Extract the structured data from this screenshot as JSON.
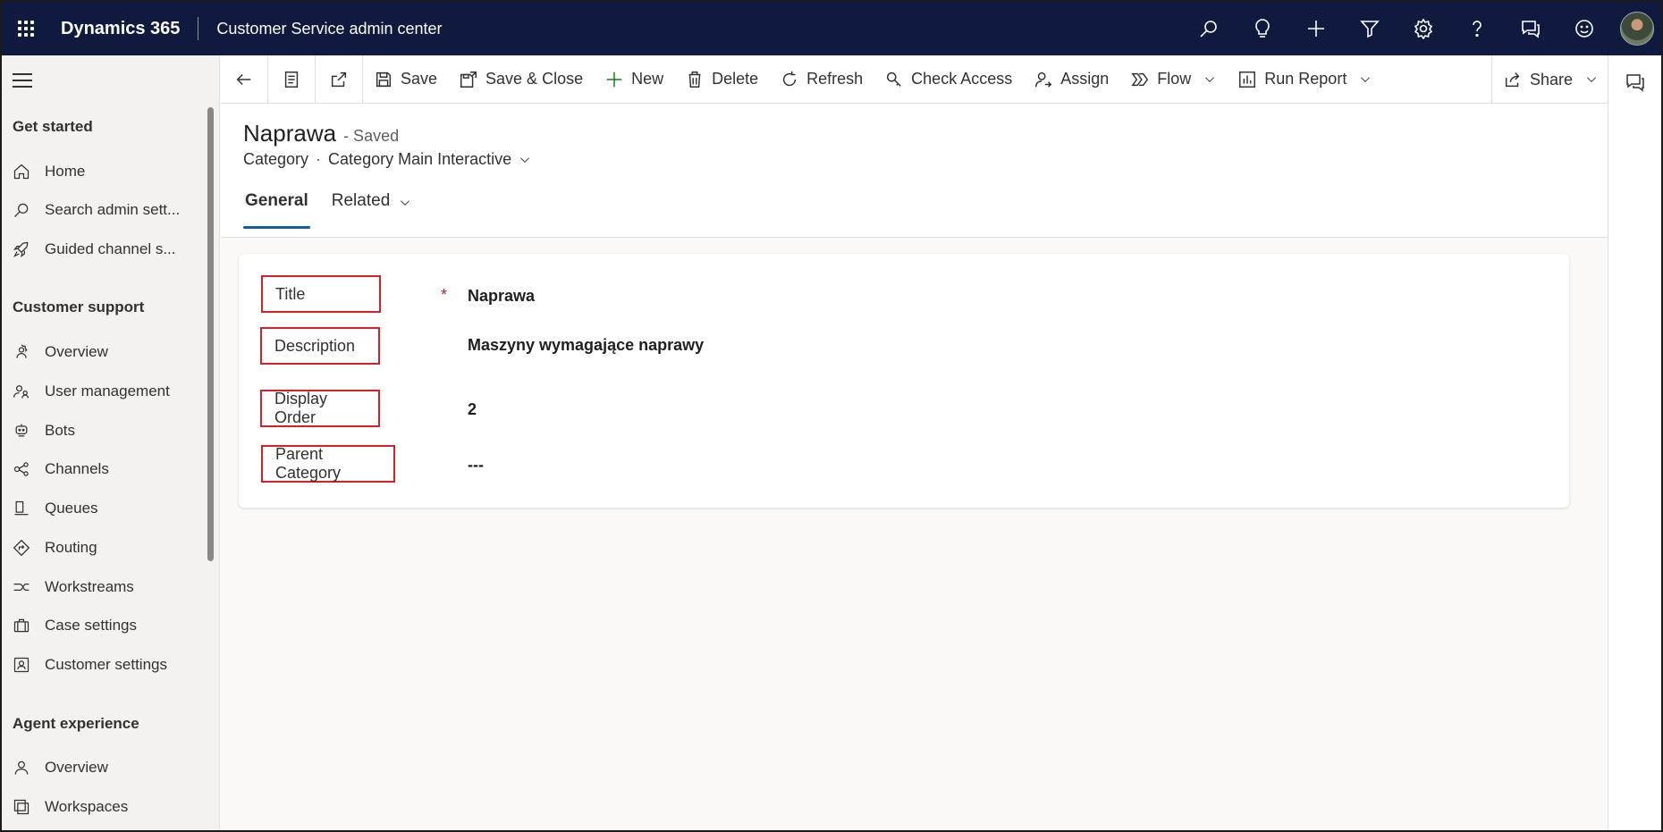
{
  "topbar": {
    "brand": "Dynamics 365",
    "app_name": "Customer Service admin center",
    "icons": [
      "search-icon",
      "lightbulb-icon",
      "plus-icon",
      "filter-icon",
      "gear-icon",
      "help-icon",
      "chat-icon",
      "smiley-icon"
    ]
  },
  "sidebar": {
    "sections": [
      {
        "title": "Get started",
        "items": [
          {
            "label": "Home",
            "icon": "home-icon"
          },
          {
            "label": "Search admin sett...",
            "icon": "search-icon"
          },
          {
            "label": "Guided channel s...",
            "icon": "rocket-icon"
          }
        ]
      },
      {
        "title": "Customer support",
        "items": [
          {
            "label": "Overview",
            "icon": "gear-people-icon"
          },
          {
            "label": "User management",
            "icon": "people-icon"
          },
          {
            "label": "Bots",
            "icon": "bot-icon"
          },
          {
            "label": "Channels",
            "icon": "channels-icon"
          },
          {
            "label": "Queues",
            "icon": "queue-icon"
          },
          {
            "label": "Routing",
            "icon": "routing-icon"
          },
          {
            "label": "Workstreams",
            "icon": "workstream-icon"
          },
          {
            "label": "Case settings",
            "icon": "briefcase-icon"
          },
          {
            "label": "Customer settings",
            "icon": "contact-card-icon"
          }
        ]
      },
      {
        "title": "Agent experience",
        "items": [
          {
            "label": "Overview",
            "icon": "person-icon"
          },
          {
            "label": "Workspaces",
            "icon": "workspaces-icon"
          }
        ]
      }
    ]
  },
  "commandbar": {
    "save": "Save",
    "save_close": "Save & Close",
    "new": "New",
    "delete": "Delete",
    "refresh": "Refresh",
    "check_access": "Check Access",
    "assign": "Assign",
    "flow": "Flow",
    "run_report": "Run Report",
    "share": "Share"
  },
  "record": {
    "title": "Naprawa",
    "status": "- Saved",
    "entity": "Category",
    "separator": "·",
    "form_name": "Category Main Interactive"
  },
  "tabs": {
    "general": "General",
    "related": "Related"
  },
  "form": {
    "required_marker": "*",
    "fields": {
      "title": {
        "label": "Title",
        "value": "Naprawa"
      },
      "description": {
        "label": "Description",
        "value": "Maszyny wymagające naprawy"
      },
      "display_order": {
        "label": "Display Order",
        "value": "2"
      },
      "parent_category": {
        "label": "Parent Category",
        "value": "---"
      }
    }
  },
  "colors": {
    "topbar": "#0f1a3e",
    "highlight": "#d61f26",
    "tab_underline": "#115ea3",
    "new_icon": "#107c10"
  }
}
